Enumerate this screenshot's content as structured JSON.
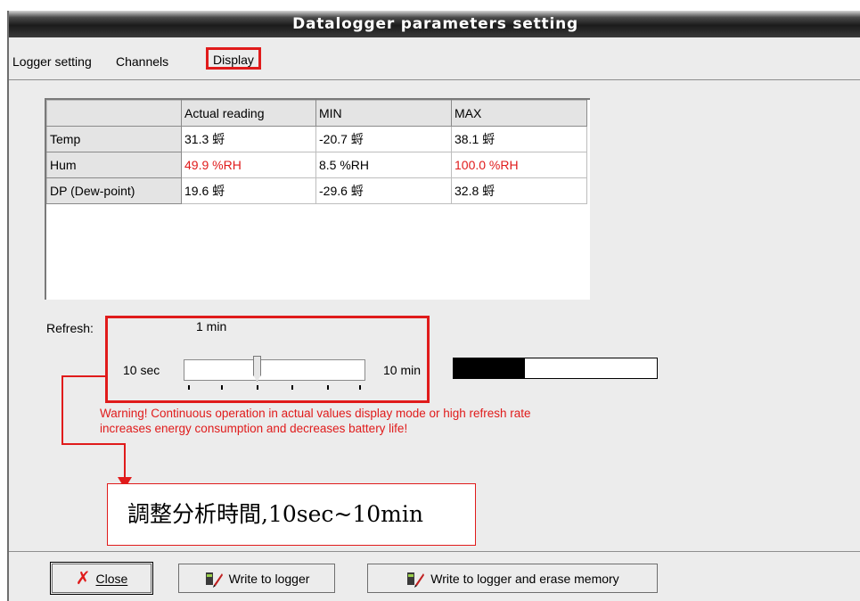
{
  "window": {
    "title": "Datalogger parameters setting"
  },
  "tabs": [
    {
      "label": "Logger setting"
    },
    {
      "label": "Channels"
    },
    {
      "label": "Display"
    }
  ],
  "table": {
    "columns": [
      "Actual reading",
      "MIN",
      "MAX"
    ],
    "rows": [
      {
        "name": "Temp",
        "actual": "31.3 蛶",
        "min": "-20.7 蛶",
        "max": "38.1 蛶"
      },
      {
        "name": "Hum",
        "actual": "49.9 %RH",
        "min": "8.5 %RH",
        "max": "100.0 %RH"
      },
      {
        "name": "DP (Dew-point)",
        "actual": "19.6 蛶",
        "min": "-29.6 蛶",
        "max": "32.8 蛶"
      }
    ]
  },
  "refresh": {
    "label": "Refresh:",
    "current": "1 min",
    "min_label": "10 sec",
    "max_label": "10 min",
    "slider_position": 0.4,
    "level_fill": 0.35
  },
  "warning": {
    "line1": "Warning! Continuous operation in actual values display mode or high refresh rate",
    "line2": "increases energy consumption and decreases battery life!"
  },
  "annotation": "調整分析時間,10sec~10min",
  "buttons": {
    "close": "Close",
    "write": "Write to logger",
    "write_erase": "Write to logger and erase memory"
  },
  "colors": {
    "accent_red": "#e01b1b",
    "panel_bg": "#ececec"
  }
}
